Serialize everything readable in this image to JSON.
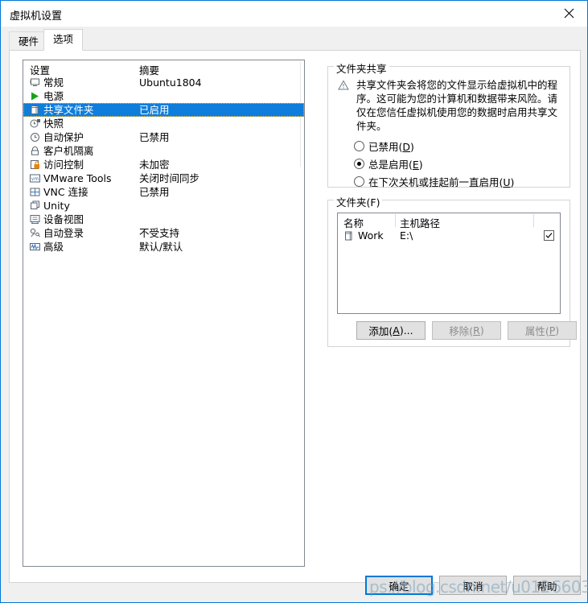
{
  "window": {
    "title": "虚拟机设置",
    "close_icon": "close-icon",
    "accent_color": "#0078d7"
  },
  "tabs": [
    {
      "label": "硬件",
      "active": false
    },
    {
      "label": "选项",
      "active": true
    }
  ],
  "settings_list": {
    "headers": {
      "name": "设置",
      "summary": "摘要"
    },
    "selected_index": 2,
    "selection_color": "#0f7ddb",
    "rows": [
      {
        "icon": "monitor-icon",
        "label": "常规",
        "summary": "Ubuntu1804"
      },
      {
        "icon": "play-icon",
        "label": "电源",
        "summary": ""
      },
      {
        "icon": "shared-folder-icon",
        "label": "共享文件夹",
        "summary": "已启用"
      },
      {
        "icon": "snapshot-clock-icon",
        "label": "快照",
        "summary": ""
      },
      {
        "icon": "autoprotect-clock-icon",
        "label": "自动保护",
        "summary": "已禁用"
      },
      {
        "icon": "lock-icon",
        "label": "客户机隔离",
        "summary": ""
      },
      {
        "icon": "access-control-icon",
        "label": "访问控制",
        "summary": "未加密"
      },
      {
        "icon": "vmware-tools-icon",
        "label": "VMware Tools",
        "summary": "关闭时间同步"
      },
      {
        "icon": "vnc-icon",
        "label": "VNC 连接",
        "summary": "已禁用"
      },
      {
        "icon": "unity-icon",
        "label": "Unity",
        "summary": ""
      },
      {
        "icon": "device-view-icon",
        "label": "设备视图",
        "summary": ""
      },
      {
        "icon": "autologon-icon",
        "label": "自动登录",
        "summary": "不受支持"
      },
      {
        "icon": "advanced-icon",
        "label": "高级",
        "summary": "默认/默认"
      }
    ]
  },
  "folder_sharing": {
    "group_title": "文件夹共享",
    "warning_icon": "warning-triangle-icon",
    "warning_text": "共享文件夹会将您的文件显示给虚拟机中的程序。这可能为您的计算机和数据带来风险。请仅在您信任虚拟机使用您的数据时启用共享文件夹。",
    "options": [
      {
        "label": "已禁用(",
        "accel": "D",
        "label_end": ")",
        "checked": false
      },
      {
        "label": "总是启用(",
        "accel": "E",
        "label_end": ")",
        "checked": true
      },
      {
        "label": "在下次关机或挂起前一直启用(",
        "accel": "U",
        "label_end": ")",
        "checked": false
      }
    ]
  },
  "folders": {
    "group_title": "文件夹(F)",
    "columns": {
      "name": "名称",
      "path": "主机路径"
    },
    "rows": [
      {
        "icon": "folder-icon",
        "name": "Work",
        "path": "E:\\",
        "enabled": true
      }
    ],
    "buttons": [
      {
        "label": "添加(",
        "accel": "A",
        "label_end": ")...",
        "disabled": false
      },
      {
        "label": "移除(",
        "accel": "R",
        "label_end": ")",
        "disabled": true
      },
      {
        "label": "属性(",
        "accel": "P",
        "label_end": ")",
        "disabled": true
      }
    ]
  },
  "footer": {
    "ok": "确定",
    "cancel": "取消",
    "help": "帮助"
  },
  "watermark": {
    "text": "ps://blog.csdn.net/u012 6603"
  }
}
